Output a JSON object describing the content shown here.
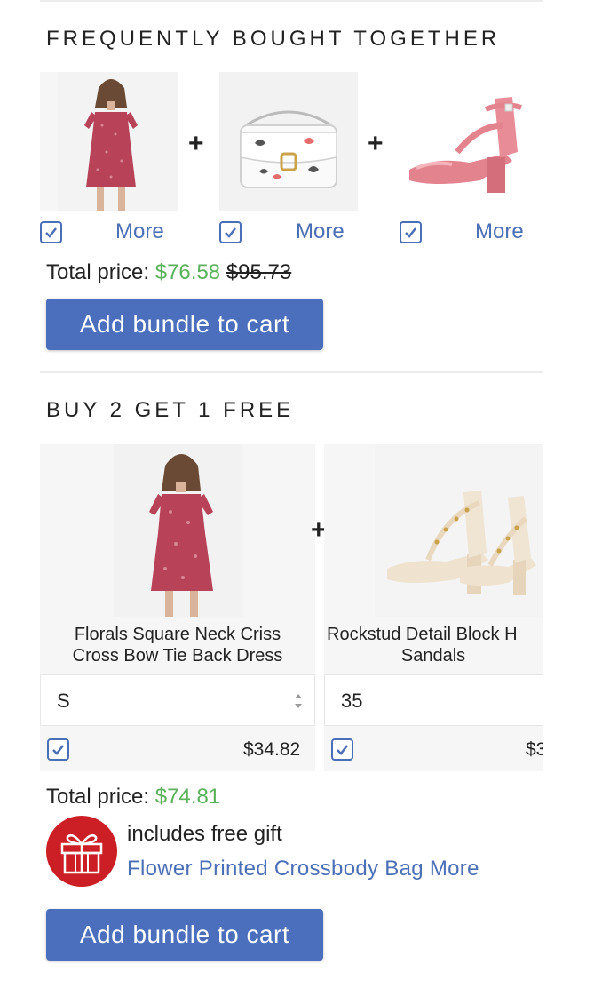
{
  "fbt": {
    "title": "FREQUENTLY BOUGHT TOGETHER",
    "items": [
      {
        "name": "dress-thumbnail",
        "more_label": "More",
        "checked": true
      },
      {
        "name": "bag-thumbnail",
        "more_label": "More",
        "checked": true
      },
      {
        "name": "sandal-thumbnail",
        "more_label": "More",
        "checked": true
      }
    ],
    "plus_symbol": "+",
    "total_label": "Total price:",
    "total_price": "$76.58",
    "original_price": "$95.73",
    "button_label": "Add bundle to cart"
  },
  "b2g1": {
    "title": "BUY 2 GET 1 FREE",
    "plus_symbol": "+",
    "products": [
      {
        "name_line1": "Florals Square Neck Criss",
        "name_line2": "Cross Bow Tie Back Dress",
        "selected_option": "S",
        "price": "$34.82",
        "checked": true
      },
      {
        "name_line1": "Rockstud Detail Block H",
        "name_line2": "Sandals",
        "selected_option": "35",
        "price": "$3",
        "checked": true
      }
    ],
    "total_label": "Total price:",
    "total_price": "$74.81",
    "gift_text": "includes free gift",
    "gift_link": "Flower Printed Crossbody Bag More",
    "button_label": "Add bundle to cart"
  },
  "colors": {
    "accent": "#4b6fbc",
    "link": "#4a6fb6",
    "price_green": "#5bb25b",
    "gift_red": "#cc1f25"
  }
}
